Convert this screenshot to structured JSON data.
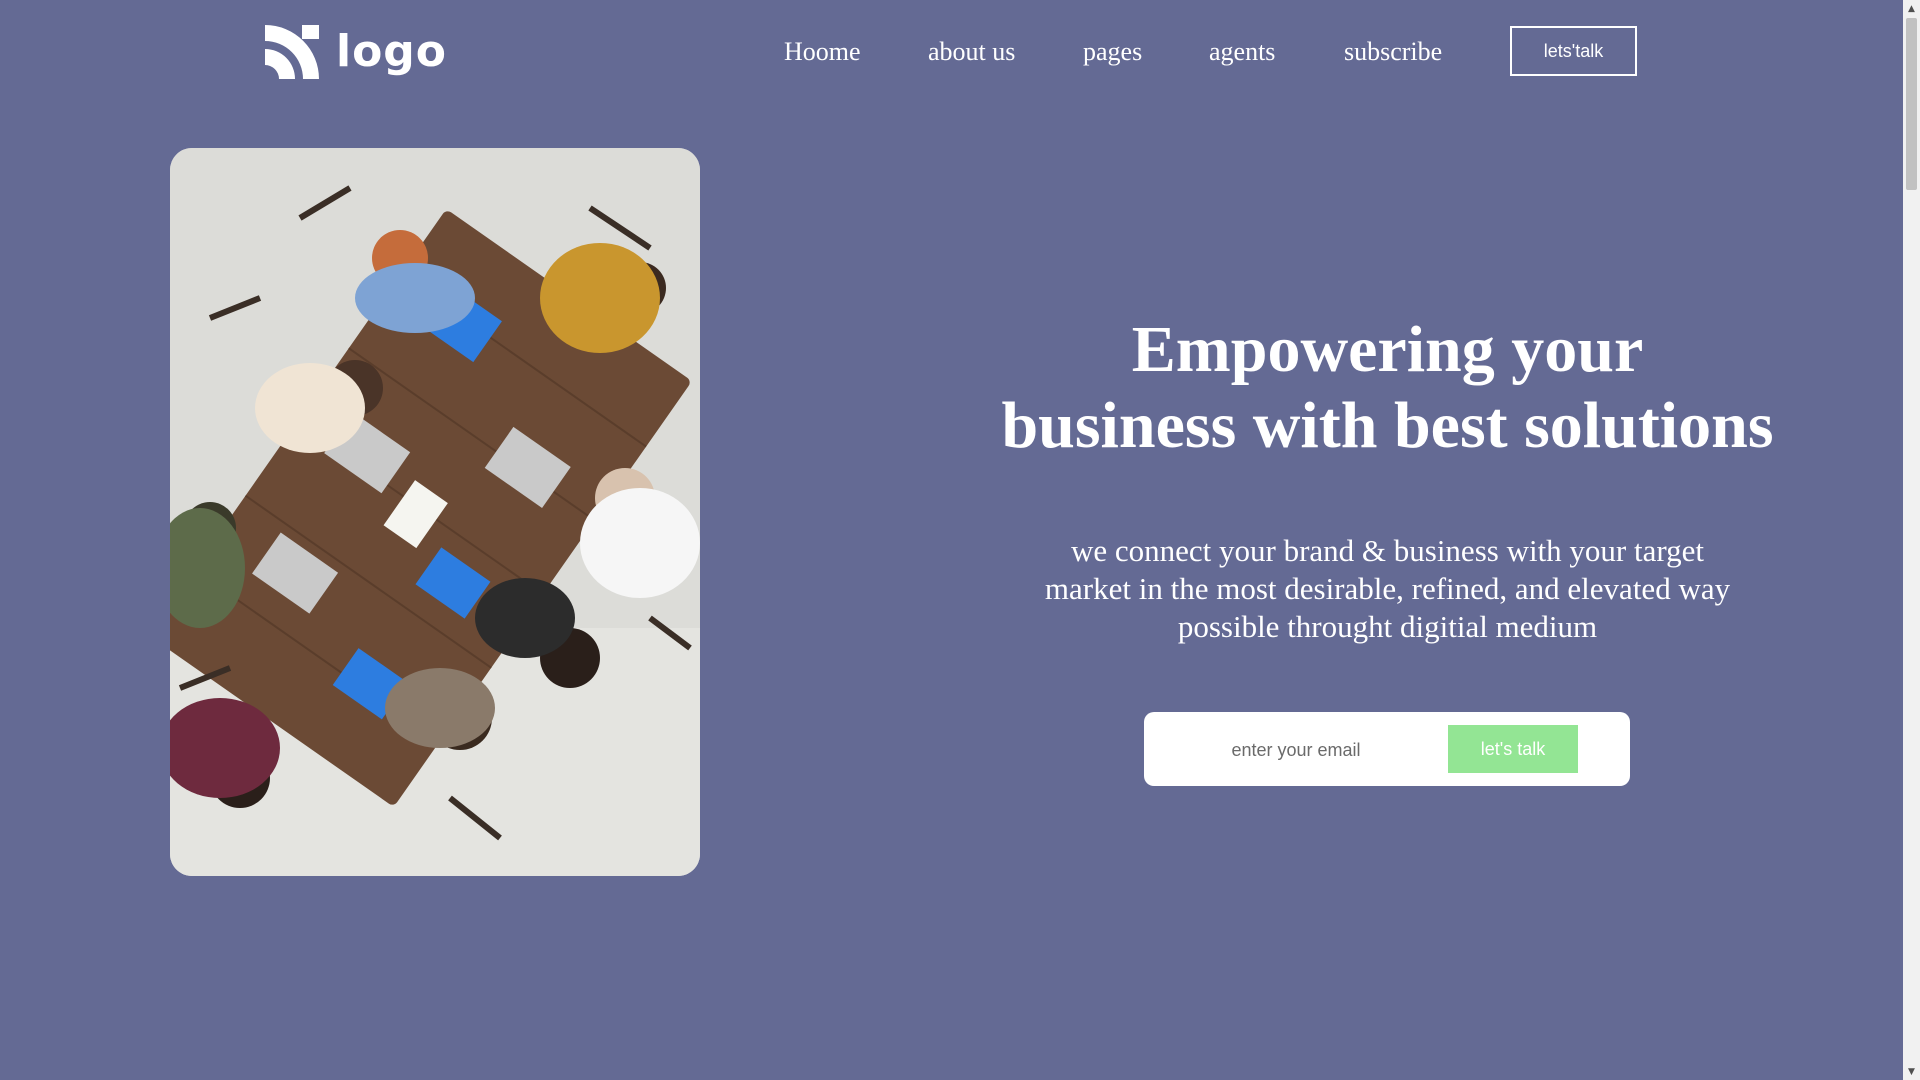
{
  "header": {
    "logo_text": "logo",
    "nav": [
      "Hoome",
      "about us",
      "pages",
      "agents",
      "subscribe"
    ],
    "cta_label": "lets'talk"
  },
  "hero": {
    "headline_line1": "Empowering your",
    "headline_line2": "business with best solutions",
    "subtext_line1": "we connect your brand & business with your target",
    "subtext_line2": "market in the most desirable, refined, and elevated way",
    "subtext_line3": "possible throught digitial medium",
    "email_placeholder": "enter your email",
    "submit_label": "let's talk",
    "image_icon": "team-meeting-photo"
  },
  "colors": {
    "background": "#646a94",
    "accent_button": "#93e594",
    "text": "#ffffff"
  }
}
